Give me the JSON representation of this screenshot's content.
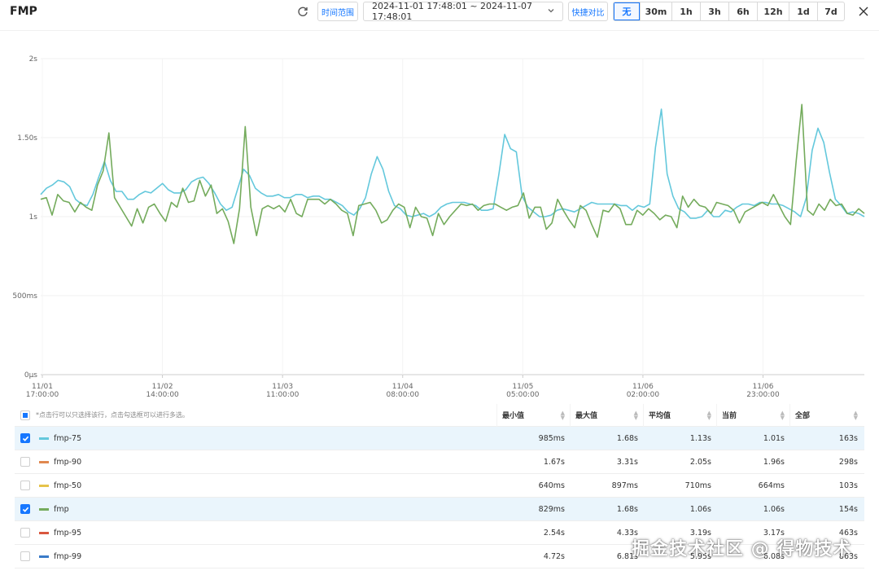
{
  "header": {
    "title": "FMP",
    "time_range_label": "时间范围",
    "date_range": "2024-11-01 17:48:01 ~ 2024-11-07 17:48:01",
    "quick_compare_label": "快捷对比",
    "intervals": [
      "无",
      "30m",
      "1h",
      "3h",
      "6h",
      "12h",
      "1d",
      "7d"
    ],
    "active_interval": "无"
  },
  "chart_data": {
    "type": "line",
    "ylabel": "",
    "y_ticks": [
      "2s",
      "1.50s",
      "1s",
      "500ms",
      "0μs"
    ],
    "ylim_ms": [
      0,
      2000
    ],
    "x_ticks": [
      [
        "11/01",
        "17:00:00"
      ],
      [
        "11/02",
        "14:00:00"
      ],
      [
        "11/03",
        "11:00:00"
      ],
      [
        "11/04",
        "08:00:00"
      ],
      [
        "11/05",
        "05:00:00"
      ],
      [
        "11/06",
        "02:00:00"
      ],
      [
        "11/06",
        "23:00:00"
      ]
    ],
    "x_range_hours": [
      0,
      144
    ],
    "series": [
      {
        "name": "fmp-75",
        "color": "#64c8dc",
        "values_ms": [
          1140,
          1180,
          1200,
          1230,
          1220,
          1190,
          1110,
          1080,
          1070,
          1140,
          1250,
          1350,
          1230,
          1160,
          1160,
          1110,
          1110,
          1140,
          1160,
          1150,
          1180,
          1210,
          1170,
          1150,
          1150,
          1170,
          1220,
          1240,
          1250,
          1210,
          1150,
          1080,
          1040,
          1060,
          1180,
          1300,
          1260,
          1180,
          1150,
          1130,
          1130,
          1140,
          1120,
          1120,
          1140,
          1140,
          1120,
          1130,
          1130,
          1110,
          1110,
          1090,
          1070,
          1030,
          1010,
          1050,
          1120,
          1270,
          1380,
          1300,
          1160,
          1070,
          1050,
          1010,
          1000,
          1010,
          1020,
          1000,
          1020,
          1060,
          1080,
          1090,
          1090,
          1090,
          1080,
          1070,
          1040,
          1040,
          1050,
          1270,
          1520,
          1430,
          1410,
          1130,
          1060,
          1030,
          1000,
          1000,
          1010,
          1040,
          1050,
          1040,
          1030,
          1050,
          1070,
          1090,
          1080,
          1080,
          1080,
          1080,
          1070,
          1070,
          1040,
          1070,
          1060,
          1080,
          1440,
          1680,
          1270,
          1130,
          1050,
          1030,
          990,
          990,
          1000,
          1040,
          1000,
          1000,
          1040,
          1030,
          1060,
          1080,
          1080,
          1070,
          1090,
          1090,
          1080,
          1080,
          1070,
          1050,
          1030,
          1000,
          1120,
          1420,
          1560,
          1470,
          1280,
          1110,
          1070,
          1020,
          1030,
          1020,
          1000
        ],
        "legend": {
          "min": "985ms",
          "max": "1.68s",
          "avg": "1.13s",
          "current": "1.01s",
          "all": "163s"
        },
        "checked": true
      },
      {
        "name": "fmp",
        "color": "#74ab5c",
        "values_ms": [
          1110,
          1120,
          1010,
          1140,
          1100,
          1090,
          1030,
          1090,
          1060,
          1040,
          1200,
          1290,
          1530,
          1120,
          1060,
          1000,
          940,
          1050,
          960,
          1060,
          1080,
          1020,
          970,
          1090,
          1060,
          1180,
          1090,
          1100,
          1230,
          1130,
          1200,
          1020,
          1050,
          970,
          830,
          1050,
          1570,
          1060,
          880,
          1050,
          1070,
          1050,
          1070,
          1030,
          1110,
          1020,
          1000,
          1110,
          1110,
          1110,
          1080,
          1110,
          1080,
          1040,
          1020,
          880,
          1070,
          1080,
          1090,
          1040,
          960,
          980,
          1040,
          1080,
          1060,
          930,
          1060,
          1000,
          990,
          880,
          1020,
          950,
          1000,
          1040,
          1080,
          1070,
          1080,
          1040,
          1070,
          1080,
          1080,
          1060,
          1040,
          1060,
          1070,
          1150,
          990,
          1060,
          1060,
          920,
          960,
          1110,
          1040,
          980,
          930,
          1070,
          1040,
          950,
          870,
          1040,
          1030,
          1080,
          1050,
          950,
          950,
          1040,
          1010,
          1050,
          1020,
          980,
          1010,
          1000,
          930,
          1130,
          1060,
          1110,
          1070,
          1060,
          1020,
          1090,
          1080,
          1070,
          1040,
          960,
          1030,
          1050,
          1070,
          1090,
          1070,
          1140,
          1070,
          1000,
          950,
          1350,
          1710,
          1040,
          1010,
          1080,
          1040,
          1110,
          1070,
          1080,
          1020,
          1010,
          1050,
          1020
        ],
        "legend": {
          "min": "829ms",
          "max": "1.68s",
          "avg": "1.06s",
          "current": "1.06s",
          "all": "154s"
        },
        "checked": true
      }
    ],
    "grid": true
  },
  "table": {
    "hint": "*点击行可以只选择该行，点击勾选框可以进行多选。",
    "columns": [
      "最小值",
      "最大值",
      "平均值",
      "当前",
      "全部"
    ],
    "rows": [
      {
        "name": "fmp-75",
        "color": "#64c8dc",
        "checked": true,
        "min": "985ms",
        "max": "1.68s",
        "avg": "1.13s",
        "current": "1.01s",
        "all": "163s"
      },
      {
        "name": "fmp-90",
        "color": "#e0884f",
        "checked": false,
        "min": "1.67s",
        "max": "3.31s",
        "avg": "2.05s",
        "current": "1.96s",
        "all": "298s"
      },
      {
        "name": "fmp-50",
        "color": "#e6c34a",
        "checked": false,
        "min": "640ms",
        "max": "897ms",
        "avg": "710ms",
        "current": "664ms",
        "all": "103s"
      },
      {
        "name": "fmp",
        "color": "#74ab5c",
        "checked": true,
        "min": "829ms",
        "max": "1.68s",
        "avg": "1.06s",
        "current": "1.06s",
        "all": "154s"
      },
      {
        "name": "fmp-95",
        "color": "#d9573f",
        "checked": false,
        "min": "2.54s",
        "max": "4.33s",
        "avg": "3.19s",
        "current": "3.17s",
        "all": "463s"
      },
      {
        "name": "fmp-99",
        "color": "#3a7bc8",
        "checked": false,
        "min": "4.72s",
        "max": "6.81s",
        "avg": "5.95s",
        "current": "6.08s",
        "all": "863s"
      }
    ]
  },
  "watermark": "掘金技术社区 @ 得物技术"
}
